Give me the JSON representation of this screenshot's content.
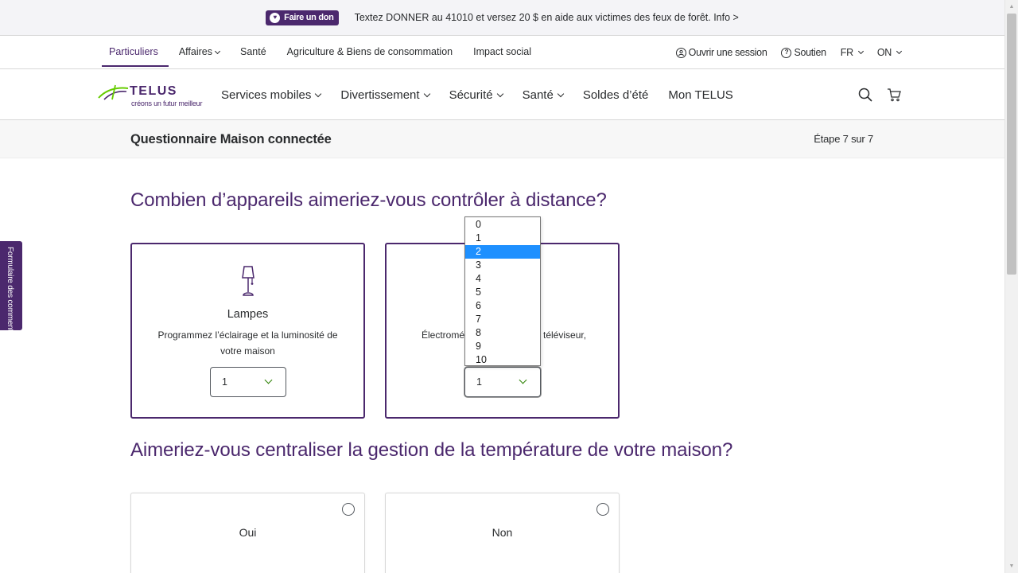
{
  "banner": {
    "donate_label": "Faire un don",
    "message": "Textez DONNER au 41010 et versez 20 $ en aide aux victimes des feux de forêt. Info >"
  },
  "topnav": {
    "items": [
      {
        "label": "Particuliers",
        "active": true
      },
      {
        "label": "Affaires",
        "has_dropdown": true
      },
      {
        "label": "Santé"
      },
      {
        "label": "Agriculture & Biens de consommation"
      },
      {
        "label": "Impact social"
      }
    ],
    "signin": "Ouvrir une session",
    "support": "Soutien",
    "language": "FR",
    "region": "ON"
  },
  "logo": {
    "word": "TELUS",
    "tagline": "créons un futur meilleur"
  },
  "mainnav": {
    "items": [
      {
        "label": "Services mobiles",
        "has_dropdown": true
      },
      {
        "label": "Divertissement",
        "has_dropdown": true
      },
      {
        "label": "Sécurité",
        "has_dropdown": true
      },
      {
        "label": "Santé",
        "has_dropdown": true
      },
      {
        "label": "Soldes d’été"
      },
      {
        "label": "Mon TELUS"
      }
    ],
    "icons": [
      "search-icon",
      "cart-icon"
    ]
  },
  "stepbar": {
    "title": "Questionnaire Maison connectée",
    "step": "Étape 7 sur 7"
  },
  "question1": {
    "text": "Combien d’appareils aimeriez-vous contrôler à distance?",
    "cards": [
      {
        "title": "Lampes",
        "description": "Programmez l’éclairage et la luminosité de votre maison",
        "select_value": "1",
        "icon": "lamp-icon"
      },
      {
        "title": "",
        "description_left": "Électromé",
        "description_right": "téléviseur,",
        "select_value": "1"
      }
    ],
    "dropdown_options": [
      "0",
      "1",
      "2",
      "3",
      "4",
      "5",
      "6",
      "7",
      "8",
      "9",
      "10"
    ],
    "dropdown_highlighted": "2"
  },
  "question2": {
    "text": "Aimeriez-vous centraliser la gestion de la température de votre maison?",
    "options": [
      {
        "label": "Oui",
        "selected": false
      },
      {
        "label": "Non",
        "selected": false
      }
    ]
  },
  "feedback_tab": "Formulaire des comment",
  "colors": {
    "brand_purple": "#4b286d",
    "brand_green": "#2b8000",
    "highlight_blue": "#1e90ff"
  }
}
